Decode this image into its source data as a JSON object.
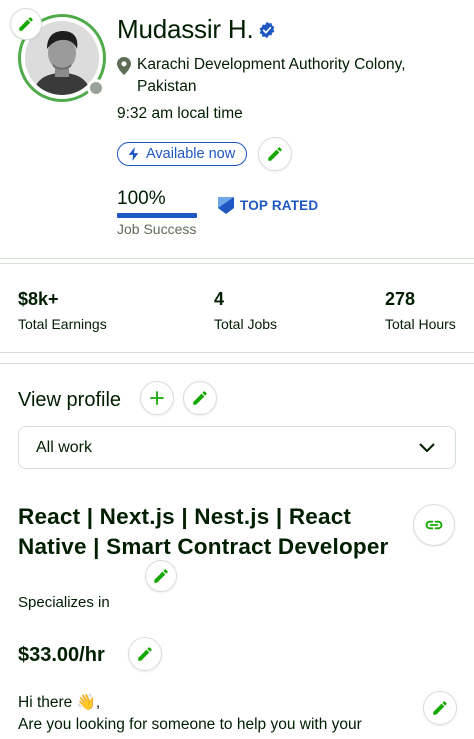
{
  "profile": {
    "name": "Mudassir H.",
    "location": "Karachi Development Authority Colony, Pakistan",
    "local_time": "9:32 am local time",
    "availability": "Available now",
    "job_success_value": "100%",
    "job_success_label": "Job Success",
    "badge": "TOP RATED"
  },
  "stats": [
    {
      "value": "$8k+",
      "label": "Total Earnings"
    },
    {
      "value": "4",
      "label": "Total Jobs"
    },
    {
      "value": "278",
      "label": "Total Hours"
    }
  ],
  "view_profile": {
    "heading": "View profile",
    "select_value": "All work"
  },
  "specialized": {
    "title": "React | Next.js | Nest.js | React Native | Smart Contract Developer",
    "subtitle": "Specializes in",
    "rate": "$33.00/hr",
    "overview_line1": "Hi there 👋,",
    "overview_line2": "Are you looking for someone to help you with your"
  },
  "icons": {
    "edit": "pencil-icon",
    "verified": "verified-badge-icon",
    "location": "location-pin-icon",
    "availability": "lightning-icon",
    "badge": "top-rated-badge-icon",
    "add": "plus-icon",
    "dropdown": "chevron-down-icon",
    "link": "link-icon"
  },
  "colors": {
    "brand_green": "#14a800",
    "accent_blue": "#1f57c3",
    "text": "#001e00",
    "muted": "#5e6d55",
    "border": "#d5e0d5"
  }
}
